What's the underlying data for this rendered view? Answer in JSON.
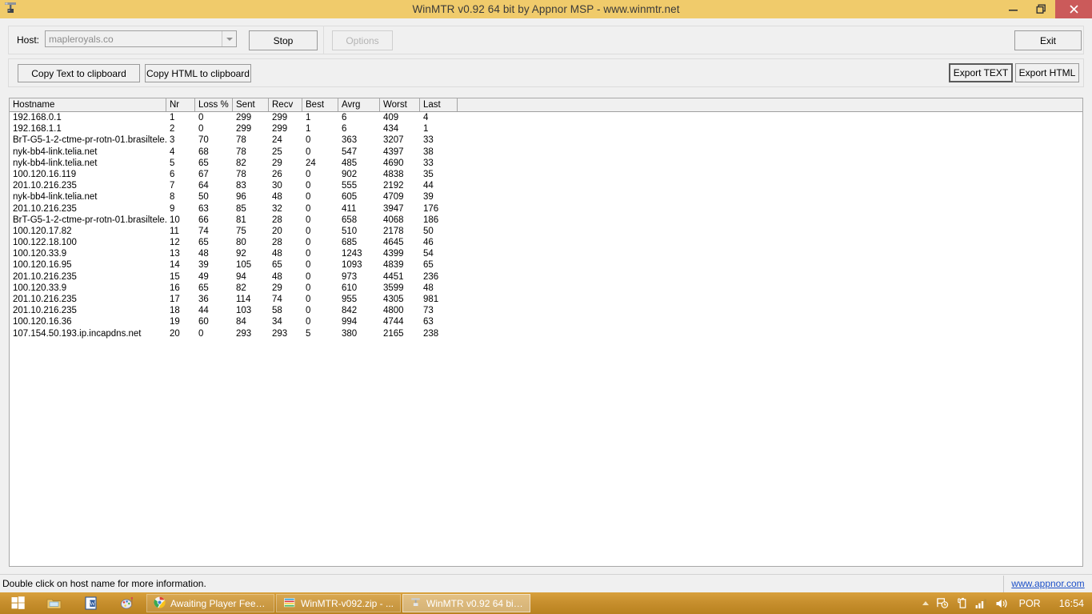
{
  "window": {
    "title": "WinMTR v0.92 64 bit by Appnor MSP - www.winmtr.net",
    "app_icon": "antenna-tower-icon",
    "minimize_label": "Minimize",
    "restore_label": "Restore",
    "close_label": "Close"
  },
  "toolbar": {
    "host_label": "Host:",
    "host_value": "mapleroyals.co",
    "host_placeholder": "",
    "stop_label": "Stop",
    "options_label": "Options",
    "exit_label": "Exit",
    "copy_text_label": "Copy Text to clipboard",
    "copy_html_label": "Copy HTML to clipboard",
    "export_text_label": "Export TEXT",
    "export_html_label": "Export HTML"
  },
  "table": {
    "columns": [
      "Hostname",
      "Nr",
      "Loss %",
      "Sent",
      "Recv",
      "Best",
      "Avrg",
      "Worst",
      "Last"
    ],
    "rows": [
      {
        "hostname": "192.168.0.1",
        "nr": "1",
        "loss": "0",
        "sent": "299",
        "recv": "299",
        "best": "1",
        "avrg": "6",
        "worst": "409",
        "last": "4"
      },
      {
        "hostname": "192.168.1.1",
        "nr": "2",
        "loss": "0",
        "sent": "299",
        "recv": "299",
        "best": "1",
        "avrg": "6",
        "worst": "434",
        "last": "1"
      },
      {
        "hostname": "BrT-G5-1-2-ctme-pr-rotn-01.brasiltele...",
        "nr": "3",
        "loss": "70",
        "sent": "78",
        "recv": "24",
        "best": "0",
        "avrg": "363",
        "worst": "3207",
        "last": "33"
      },
      {
        "hostname": "nyk-bb4-link.telia.net",
        "nr": "4",
        "loss": "68",
        "sent": "78",
        "recv": "25",
        "best": "0",
        "avrg": "547",
        "worst": "4397",
        "last": "38"
      },
      {
        "hostname": "nyk-bb4-link.telia.net",
        "nr": "5",
        "loss": "65",
        "sent": "82",
        "recv": "29",
        "best": "24",
        "avrg": "485",
        "worst": "4690",
        "last": "33"
      },
      {
        "hostname": "100.120.16.119",
        "nr": "6",
        "loss": "67",
        "sent": "78",
        "recv": "26",
        "best": "0",
        "avrg": "902",
        "worst": "4838",
        "last": "35"
      },
      {
        "hostname": "201.10.216.235",
        "nr": "7",
        "loss": "64",
        "sent": "83",
        "recv": "30",
        "best": "0",
        "avrg": "555",
        "worst": "2192",
        "last": "44"
      },
      {
        "hostname": "nyk-bb4-link.telia.net",
        "nr": "8",
        "loss": "50",
        "sent": "96",
        "recv": "48",
        "best": "0",
        "avrg": "605",
        "worst": "4709",
        "last": "39"
      },
      {
        "hostname": "201.10.216.235",
        "nr": "9",
        "loss": "63",
        "sent": "85",
        "recv": "32",
        "best": "0",
        "avrg": "411",
        "worst": "3947",
        "last": "176"
      },
      {
        "hostname": "BrT-G5-1-2-ctme-pr-rotn-01.brasiltele...",
        "nr": "10",
        "loss": "66",
        "sent": "81",
        "recv": "28",
        "best": "0",
        "avrg": "658",
        "worst": "4068",
        "last": "186"
      },
      {
        "hostname": "100.120.17.82",
        "nr": "11",
        "loss": "74",
        "sent": "75",
        "recv": "20",
        "best": "0",
        "avrg": "510",
        "worst": "2178",
        "last": "50"
      },
      {
        "hostname": "100.122.18.100",
        "nr": "12",
        "loss": "65",
        "sent": "80",
        "recv": "28",
        "best": "0",
        "avrg": "685",
        "worst": "4645",
        "last": "46"
      },
      {
        "hostname": "100.120.33.9",
        "nr": "13",
        "loss": "48",
        "sent": "92",
        "recv": "48",
        "best": "0",
        "avrg": "1243",
        "worst": "4399",
        "last": "54"
      },
      {
        "hostname": "100.120.16.95",
        "nr": "14",
        "loss": "39",
        "sent": "105",
        "recv": "65",
        "best": "0",
        "avrg": "1093",
        "worst": "4839",
        "last": "65"
      },
      {
        "hostname": "201.10.216.235",
        "nr": "15",
        "loss": "49",
        "sent": "94",
        "recv": "48",
        "best": "0",
        "avrg": "973",
        "worst": "4451",
        "last": "236"
      },
      {
        "hostname": "100.120.33.9",
        "nr": "16",
        "loss": "65",
        "sent": "82",
        "recv": "29",
        "best": "0",
        "avrg": "610",
        "worst": "3599",
        "last": "48"
      },
      {
        "hostname": "201.10.216.235",
        "nr": "17",
        "loss": "36",
        "sent": "114",
        "recv": "74",
        "best": "0",
        "avrg": "955",
        "worst": "4305",
        "last": "981"
      },
      {
        "hostname": "201.10.216.235",
        "nr": "18",
        "loss": "44",
        "sent": "103",
        "recv": "58",
        "best": "0",
        "avrg": "842",
        "worst": "4800",
        "last": "73"
      },
      {
        "hostname": "100.120.16.36",
        "nr": "19",
        "loss": "60",
        "sent": "84",
        "recv": "34",
        "best": "0",
        "avrg": "994",
        "worst": "4744",
        "last": "63"
      },
      {
        "hostname": "107.154.50.193.ip.incapdns.net",
        "nr": "20",
        "loss": "0",
        "sent": "293",
        "recv": "293",
        "best": "5",
        "avrg": "380",
        "worst": "2165",
        "last": "238"
      }
    ]
  },
  "statusbar": {
    "message": "Double click on host name for more information.",
    "link": "www.appnor.com"
  },
  "taskbar": {
    "start_label": "Start",
    "quick_launch": [
      {
        "name": "file-explorer-icon",
        "label": "File Explorer"
      },
      {
        "name": "word-icon",
        "label": "Microsoft Word"
      },
      {
        "name": "paint-icon",
        "label": "Paint"
      }
    ],
    "tasks": [
      {
        "icon": "chrome-icon",
        "label": "Awaiting Player Feed...",
        "active": false
      },
      {
        "icon": "winrar-icon",
        "label": "WinMTR-v092.zip - ...",
        "active": false
      },
      {
        "icon": "winmtr-icon",
        "label": "WinMTR v0.92 64 bit ...",
        "active": true
      }
    ],
    "tray": {
      "language": "POR",
      "clock": "16:54"
    }
  },
  "colors": {
    "titlebar": "#f0cb6b",
    "close_button": "#cb5a5a",
    "taskbar": "#c78f2e",
    "link": "#1c50c8",
    "client": "#f0f0f0"
  }
}
